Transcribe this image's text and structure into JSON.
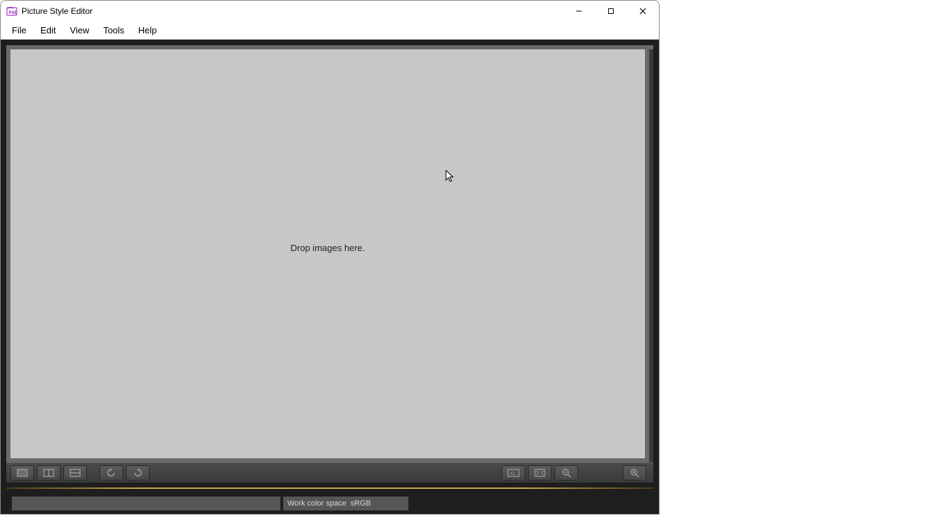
{
  "window": {
    "title": "Picture Style Editor"
  },
  "menu": {
    "file": "File",
    "edit": "Edit",
    "view": "View",
    "tools": "Tools",
    "help": "Help"
  },
  "canvas": {
    "drop_text": "Drop images here."
  },
  "status": {
    "colorspace_label": "Work color space",
    "colorspace_value": "sRGB"
  },
  "icons": {
    "minimize": "—",
    "close": "✕"
  }
}
